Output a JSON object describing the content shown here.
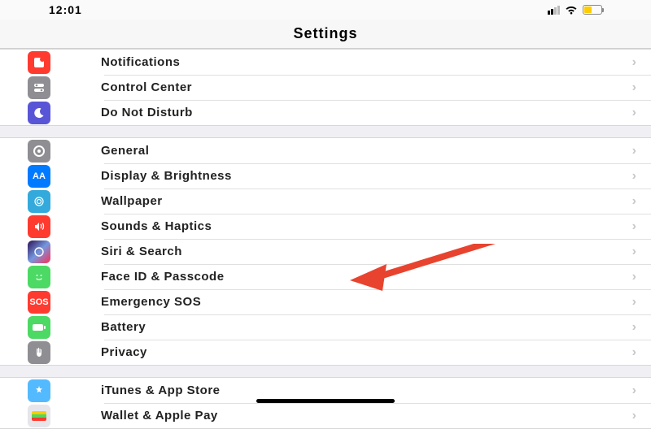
{
  "status": {
    "time": "12:01"
  },
  "title": "Settings",
  "groups": [
    {
      "items": [
        {
          "key": "notifications",
          "label": "Notifications"
        },
        {
          "key": "control-center",
          "label": "Control Center"
        },
        {
          "key": "do-not-disturb",
          "label": "Do Not Disturb"
        }
      ]
    },
    {
      "items": [
        {
          "key": "general",
          "label": "General"
        },
        {
          "key": "display",
          "label": "Display & Brightness"
        },
        {
          "key": "wallpaper",
          "label": "Wallpaper"
        },
        {
          "key": "sounds",
          "label": "Sounds & Haptics"
        },
        {
          "key": "siri",
          "label": "Siri & Search"
        },
        {
          "key": "faceid",
          "label": "Face ID & Passcode"
        },
        {
          "key": "sos",
          "label": "Emergency SOS",
          "icon_text": "SOS"
        },
        {
          "key": "battery",
          "label": "Battery"
        },
        {
          "key": "privacy",
          "label": "Privacy"
        }
      ]
    },
    {
      "items": [
        {
          "key": "itunes",
          "label": "iTunes & App Store"
        },
        {
          "key": "wallet",
          "label": "Wallet & Apple Pay"
        }
      ]
    }
  ],
  "annotation": {
    "points_to": "faceid"
  }
}
